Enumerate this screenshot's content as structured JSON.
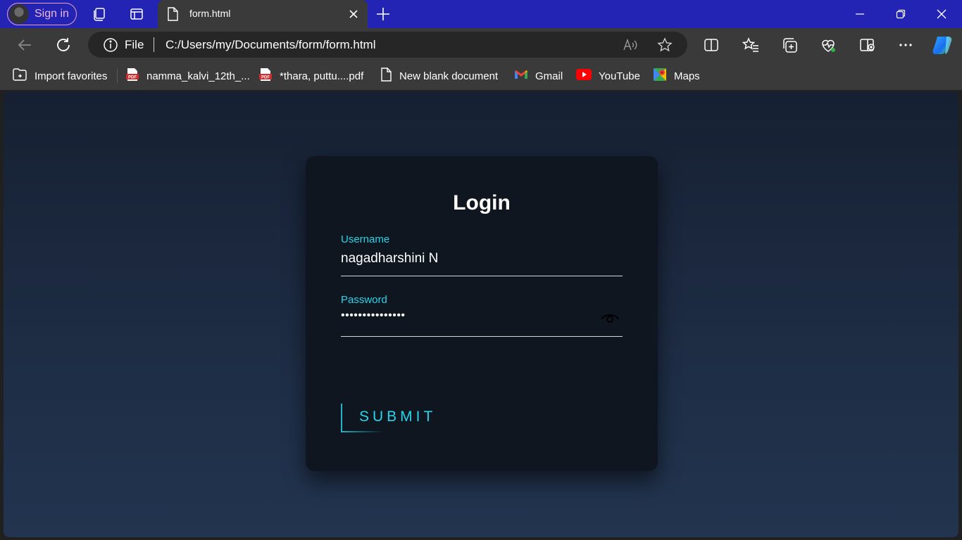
{
  "browser": {
    "sign_in_label": "Sign in",
    "tab": {
      "title": "form.html"
    },
    "address": {
      "scheme_label": "File",
      "url": "C:/Users/my/Documents/form/form.html"
    },
    "bookmarks": [
      {
        "label": "Import favorites",
        "icon": "import-icon"
      },
      {
        "label": "namma_kalvi_12th_...",
        "icon": "pdf-icon"
      },
      {
        "label": "*thara, puttu....pdf",
        "icon": "pdf-icon"
      },
      {
        "label": "New blank document",
        "icon": "document-icon"
      },
      {
        "label": "Gmail",
        "icon": "gmail-icon"
      },
      {
        "label": "YouTube",
        "icon": "youtube-icon"
      },
      {
        "label": "Maps",
        "icon": "maps-icon"
      }
    ]
  },
  "form": {
    "title": "Login",
    "username_label": "Username",
    "username_value": "nagadharshini N",
    "password_label": "Password",
    "password_masked": "•••••••••••••••",
    "submit_label": "SUBMIT"
  },
  "colors": {
    "tabbar": "#2323b4",
    "accent": "#27d5ea",
    "card": "#0f1620"
  }
}
